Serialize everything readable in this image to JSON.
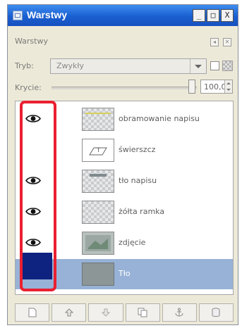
{
  "window": {
    "title": "Warstwy",
    "minimize_label": "_",
    "maximize_label": "□",
    "close_label": "X"
  },
  "panel": {
    "header": "Warstwy",
    "mode_label": "Tryb:",
    "mode_value": "Zwykły",
    "opacity_label": "Krycie:",
    "opacity_value": "100,0"
  },
  "layers": [
    {
      "name": "obramowanie napisu",
      "visible": true,
      "selected": false,
      "icon": "eye-icon"
    },
    {
      "name": "świerszcz",
      "visible": false,
      "selected": false,
      "icon": ""
    },
    {
      "name": "tło napisu",
      "visible": true,
      "selected": false,
      "icon": "eye-icon"
    },
    {
      "name": "żółta ramka",
      "visible": true,
      "selected": false,
      "icon": "eye-icon"
    },
    {
      "name": "zdjęcie",
      "visible": true,
      "selected": false,
      "icon": "eye-icon"
    },
    {
      "name": "Tło",
      "visible": false,
      "selected": true,
      "icon": ""
    }
  ],
  "bottom_buttons": [
    "new-layer-icon",
    "raise-layer-icon",
    "lower-layer-icon",
    "duplicate-layer-icon",
    "anchor-layer-icon",
    "delete-layer-icon"
  ],
  "colors": {
    "titlebar": "#1a5fd0",
    "selection": "#97b2d6",
    "highlight": "#ea2030",
    "active_indicator": "#0e2280"
  }
}
